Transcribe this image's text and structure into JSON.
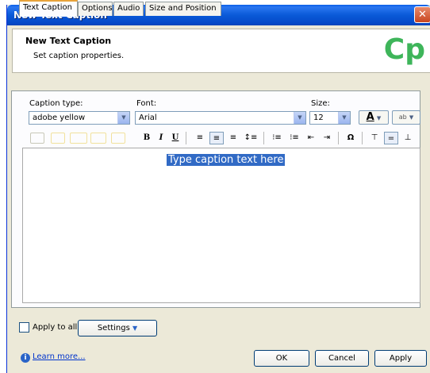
{
  "window": {
    "title": "New Text Caption",
    "close_glyph": "✕"
  },
  "header": {
    "title": "New Text Caption",
    "subtitle": "Set caption properties.",
    "logo": "Cp"
  },
  "tabs": [
    "Text Caption",
    "Options",
    "Audio",
    "Size and Position"
  ],
  "form": {
    "caption_type_label": "Caption type:",
    "caption_type_value": "adobe yellow",
    "font_label": "Font:",
    "font_value": "Arial",
    "size_label": "Size:",
    "size_value": "12"
  },
  "toolbar": {
    "text_color_glyph": "A",
    "highlight_glyph": "ab",
    "bold": "B",
    "italic": "I",
    "underline": "U",
    "align_left": "≡",
    "align_center": "≡",
    "align_right": "≡",
    "line_spacing": "↕≡",
    "bullets": "⁝≡",
    "numbered": "⁝≡",
    "outdent": "⇤",
    "indent": "⇥",
    "symbol": "Ω",
    "valign_top": "⊤",
    "valign_middle": "=",
    "valign_bottom": "⊥"
  },
  "editor": {
    "text": "Type caption text here"
  },
  "footer": {
    "apply_to_all_label": "Apply to all",
    "settings_label": "Settings",
    "learn_more": "Learn more...",
    "ok": "OK",
    "cancel": "Cancel",
    "apply": "Apply"
  },
  "colors": {
    "title_bar": "#0a5ad8",
    "logo_green": "#3eb55a",
    "selection": "#316ac5",
    "tab_accent": "#e8a33a"
  }
}
